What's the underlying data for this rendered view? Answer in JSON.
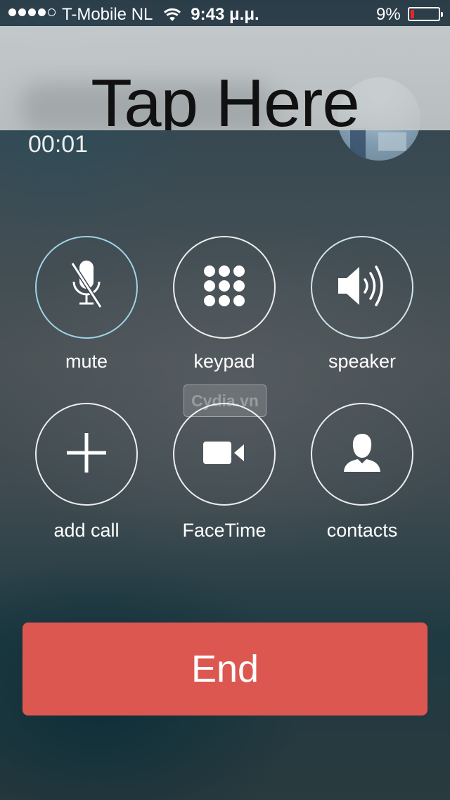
{
  "status_bar": {
    "carrier": "T-Mobile NL",
    "time": "9:43 μ.μ.",
    "battery_percent": "9%",
    "battery_level": 0.09,
    "battery_color": "#e8252a",
    "signal_bars": 4,
    "signal_total": 5
  },
  "banner": {
    "text": "Tap Here"
  },
  "call": {
    "duration": "00:01"
  },
  "controls": {
    "mute": {
      "label": "mute",
      "icon": "microphone-slash-icon"
    },
    "keypad": {
      "label": "keypad",
      "icon": "keypad-grid-icon"
    },
    "speaker": {
      "label": "speaker",
      "icon": "speaker-icon"
    },
    "add_call": {
      "label": "add call",
      "icon": "plus-icon"
    },
    "facetime": {
      "label": "FaceTime",
      "icon": "video-camera-icon"
    },
    "contacts": {
      "label": "contacts",
      "icon": "person-silhouette-icon"
    }
  },
  "watermark": {
    "text": "Cydia.vn"
  },
  "end_button": {
    "label": "End",
    "color": "#dd5751"
  }
}
